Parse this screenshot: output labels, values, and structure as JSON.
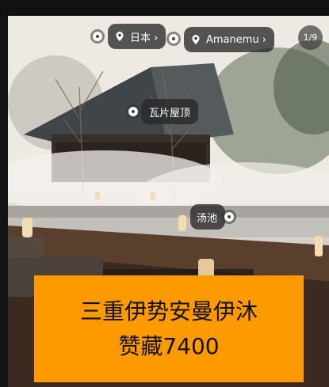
{
  "tags": {
    "japan": "日本 ›",
    "amanemu": "Amanemu ›",
    "roof": "瓦片屋顶",
    "pool": "汤池"
  },
  "counter": "1/9",
  "banner": {
    "line1": "三重伊势安曼伊沐",
    "line2": "赞藏7400"
  },
  "icons": {
    "pin": "location-pin-icon",
    "dot": "tag-dot-icon"
  },
  "colors": {
    "banner": "#fd9a00",
    "chip": "rgba(40,40,40,0.78)"
  }
}
